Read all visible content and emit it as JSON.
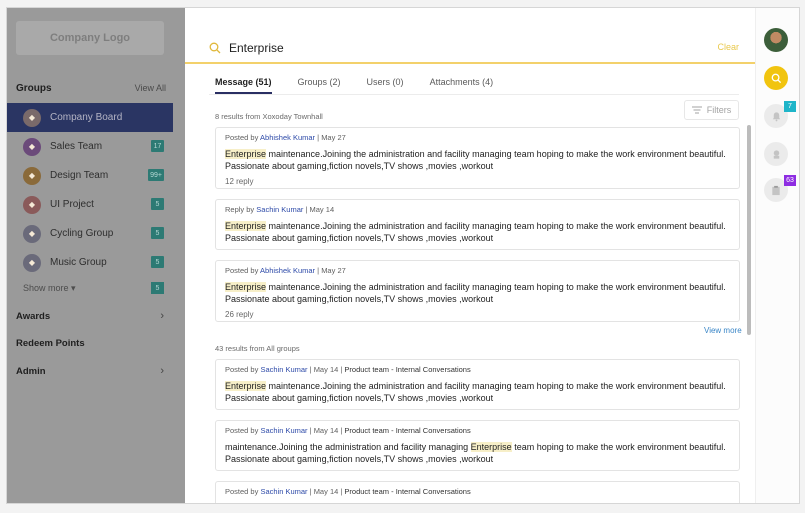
{
  "sidebar": {
    "logo": "Company Logo",
    "groups_title": "Groups",
    "view_all": "View All",
    "groups": [
      {
        "label": "Company Board",
        "badge": "",
        "active": true
      },
      {
        "label": "Sales Team",
        "badge": "17"
      },
      {
        "label": "Design Team",
        "badge": "99+"
      },
      {
        "label": "UI Project",
        "badge": "5"
      },
      {
        "label": "Cycling Group",
        "badge": "5"
      },
      {
        "label": "Music Group",
        "badge": "5"
      }
    ],
    "show_more": "Show more",
    "show_more_badge": "5",
    "awards": "Awards",
    "redeem_points": "Redeem Points",
    "admin": "Admin"
  },
  "search": {
    "query": "Enterprise",
    "clear": "Clear",
    "tabs": [
      {
        "label": "Message (51)",
        "active": true
      },
      {
        "label": "Groups (2)"
      },
      {
        "label": "Users (0)"
      },
      {
        "label": "Attachments (4)"
      }
    ],
    "filters": "Filters",
    "section1_info": "8 results from Xoxoday Townhall",
    "section2_info": "43 results from All groups",
    "view_more": "View more",
    "results": [
      {
        "prefix": "Posted by",
        "author": "Abhishek Kumar",
        "date": "May 27",
        "group": "",
        "hl_pre": "",
        "hl": "Enterprise",
        "text": " maintenance.Joining the administration and facility managing team hoping to make the work environment beautiful. Passionate about gaming,fiction novels,TV shows      ,movies      ,workout",
        "reply": "12 reply"
      },
      {
        "prefix": "Reply by",
        "author": "Sachin Kumar",
        "date": "May 14",
        "group": "",
        "hl_pre": "",
        "hl": "Enterprise",
        "text": " maintenance.Joining the administration and facility managing team hoping to make the work environment beautiful. Passionate about gaming,fiction novels,TV shows      ,movies      ,workout",
        "reply": ""
      },
      {
        "prefix": "Posted by",
        "author": "Abhishek Kumar",
        "date": "May 27",
        "group": "",
        "hl_pre": "",
        "hl": "Enterprise",
        "text": " maintenance.Joining the administration and facility managing team hoping to make the work environment beautiful. Passionate about gaming,fiction novels,TV shows      ,movies      ,workout",
        "reply": "26 reply"
      },
      {
        "prefix": "Posted by",
        "author": "Sachin Kumar",
        "date": "May 14",
        "group": "Product team - Internal Conversations",
        "hl_pre": "",
        "hl": "Enterprise",
        "text": " maintenance.Joining the administration and facility managing team hoping to make the work environment beautiful. Passionate about gaming,fiction novels,TV shows      ,movies      ,workout",
        "reply": ""
      },
      {
        "prefix": "Posted by",
        "author": "Sachin Kumar",
        "date": "May 14",
        "group": "Product team - Internal Conversations",
        "hl_pre": "maintenance.Joining the administration and facility managing ",
        "hl": "Enterprise",
        "text": " team hoping to make the work environment beautiful. Passionate about gaming,fiction novels,TV shows      ,movies      ,workout",
        "reply": ""
      },
      {
        "prefix": "Posted by",
        "author": "Sachin Kumar",
        "date": "May 14",
        "group": "Product team - Internal Conversations",
        "hl_pre": "",
        "hl": "",
        "text": "",
        "reply": ""
      }
    ]
  },
  "rail": {
    "notifications_badge": "7",
    "tasks_badge": "63",
    "colors": {
      "accent": "#f1c40f",
      "badge_teal": "#1fb5c9",
      "badge_purple": "#8e2de2"
    }
  }
}
